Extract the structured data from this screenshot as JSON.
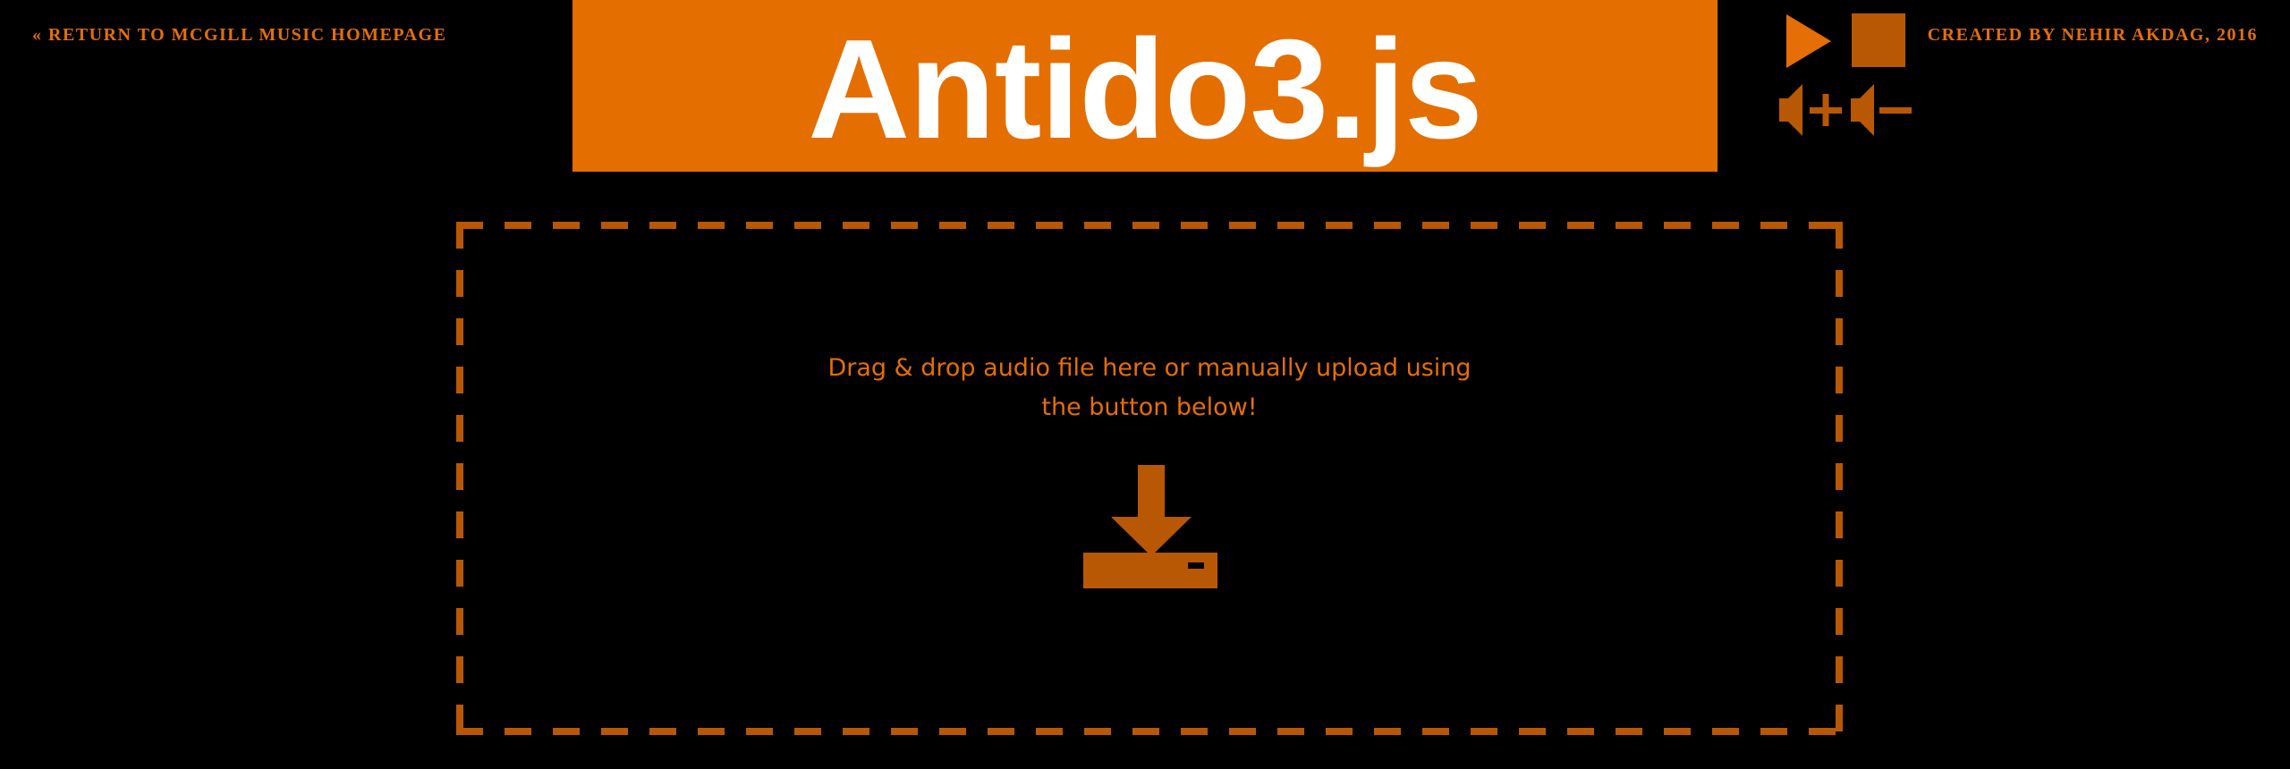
{
  "header": {
    "return_link": "« RETURN TO MCGILL MUSIC HOMEPAGE",
    "title": "Antido3.js",
    "credit": "CREATED BY NEHIR AKDAG, 2016"
  },
  "controls": {
    "play_icon": "play-icon",
    "stop_icon": "stop-icon",
    "volume_up_icon": "volume-up-icon",
    "volume_down_icon": "volume-down-icon"
  },
  "dropzone": {
    "message": "Drag & drop audio file here or manually upload using the button below!",
    "upload_icon": "download-to-drive-icon"
  },
  "colors": {
    "background": "#000000",
    "banner": "#e56e00",
    "accent_text": "#e56e07",
    "icon": "#b95804",
    "title_text": "#ffffff"
  }
}
